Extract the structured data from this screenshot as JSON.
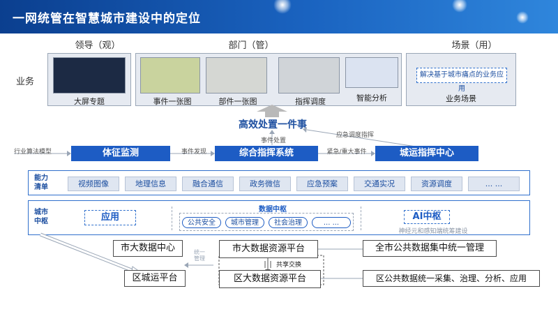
{
  "title": "一网统管在智慧城市建设中的定位",
  "columns": {
    "leader": "领导（观）",
    "dept": "部门（管）",
    "scene": "场景（用）"
  },
  "row_label": "业务",
  "thumbnails": [
    "大屏专题",
    "事件一张图",
    "部件一张图",
    "指挥调度",
    "智能分析"
  ],
  "scene_box": "解决基于城市痛点的业务应用",
  "scene_caption": "业务场景",
  "headline": "高效处置一件事",
  "flow": {
    "model_label": "行业算法模型",
    "box1": "体征监测",
    "edge1": "事件发现",
    "box2": "综合指挥系统",
    "edge2": "紧急/重大事件",
    "box3": "城运指挥中心",
    "up_label": "事件处置",
    "diag_label": "应急调度指挥"
  },
  "capability": {
    "label_line1": "能力",
    "label_line2": "清单",
    "items": [
      "视频图像",
      "地理信息",
      "融合通信",
      "政务微信",
      "应急预案",
      "交通实况",
      "资源调度",
      "... ..."
    ]
  },
  "hub": {
    "label_line1": "城市",
    "label_line2": "中枢",
    "app": "应用",
    "data_title": "数据中枢",
    "pills": [
      "公共安全",
      "城市管理",
      "社会治理",
      "... ..."
    ],
    "ai": "AI中枢",
    "ai_sub": "神经元和感知端统筹建设"
  },
  "bottom": {
    "city_center": "市大数据中心",
    "district_platform": "区城运平台",
    "unified_label": "统一管理",
    "city_resource": "市大数据资源平台",
    "share": "共享交换",
    "district_resource": "区大数据资源平台",
    "right_top": "全市公共数据集中统一管理",
    "right_bottom": "区公共数据统一采集、治理、分析、应用"
  },
  "colors": {
    "banner": "#1a63c0",
    "accent": "#1d5cc4"
  }
}
